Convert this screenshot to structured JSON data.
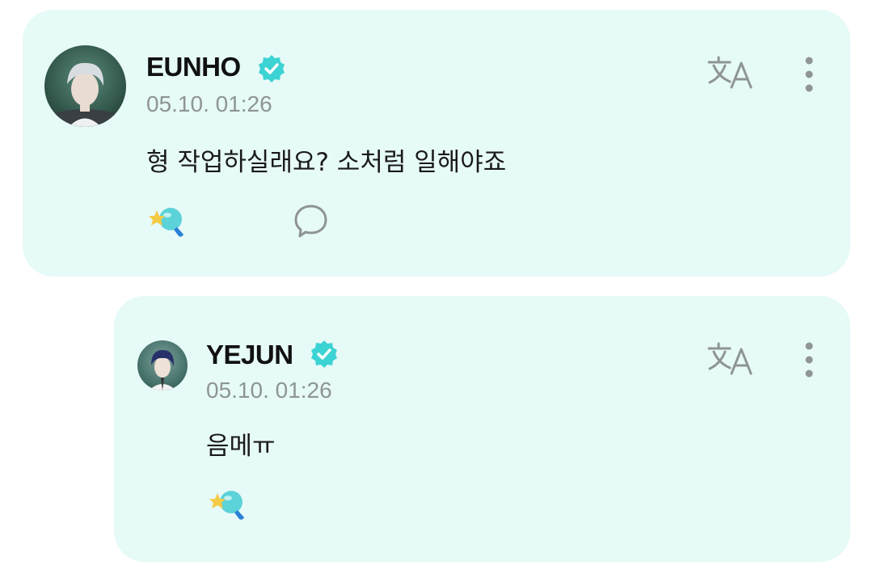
{
  "posts": [
    {
      "author": "EUNHO",
      "verified": true,
      "timestamp": "05.10. 01:26",
      "content": "형 작업하실래요? 소처럼 일해야죠",
      "actions": [
        "translate-icon",
        "more-options-icon",
        "reaction-icon",
        "comment-icon"
      ]
    },
    {
      "author": "YEJUN",
      "verified": true,
      "timestamp": "05.10. 01:26",
      "content": "음메ㅠ",
      "actions": [
        "translate-icon",
        "more-options-icon",
        "reaction-icon"
      ]
    }
  ],
  "colors": {
    "card_background": "#e6faf7",
    "verified_badge": "#3cd3d4",
    "icon_gray": "#8e9594"
  }
}
